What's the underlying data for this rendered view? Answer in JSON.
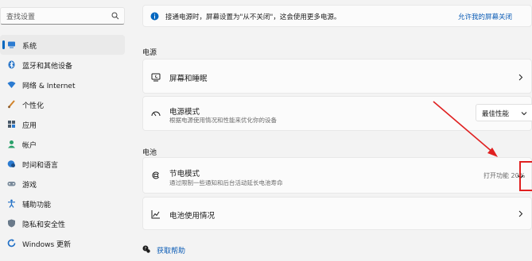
{
  "search": {
    "placeholder": "查找设置"
  },
  "nav": {
    "items": [
      {
        "label": "系统",
        "icon": "display-icon",
        "active": true
      },
      {
        "label": "蓝牙和其他设备",
        "icon": "bluetooth-icon"
      },
      {
        "label": "网络 & Internet",
        "icon": "wifi-icon"
      },
      {
        "label": "个性化",
        "icon": "brush-icon"
      },
      {
        "label": "应用",
        "icon": "apps-icon"
      },
      {
        "label": "帐户",
        "icon": "account-icon"
      },
      {
        "label": "时间和语言",
        "icon": "globe-clock-icon"
      },
      {
        "label": "游戏",
        "icon": "gamepad-icon"
      },
      {
        "label": "辅助功能",
        "icon": "accessibility-icon"
      },
      {
        "label": "隐私和安全性",
        "icon": "shield-icon"
      },
      {
        "label": "Windows 更新",
        "icon": "windows-update-icon"
      }
    ]
  },
  "banner": {
    "text": "接通电源时，屏幕设置为\"从不关闭\"，这会使用更多电源。",
    "link": "允许我的屏幕关闭"
  },
  "sections": {
    "power": "电源",
    "battery": "电池"
  },
  "cards": {
    "screen_sleep": {
      "title": "屏幕和睡眠"
    },
    "power_mode": {
      "title": "电源模式",
      "subtitle": "根据电源使用情况和性能来优化你的设备",
      "value": "最佳性能"
    },
    "battery_saver": {
      "title": "节电模式",
      "subtitle": "通过限制一些通知和后台活动延长电池寿命",
      "status": "打开功能 20%"
    },
    "battery_usage": {
      "title": "电池使用情况"
    }
  },
  "help": {
    "label": "获取帮助"
  },
  "colors": {
    "accent": "#0067c0",
    "link": "#0a5bb5",
    "annotation_red": "#e02020"
  }
}
